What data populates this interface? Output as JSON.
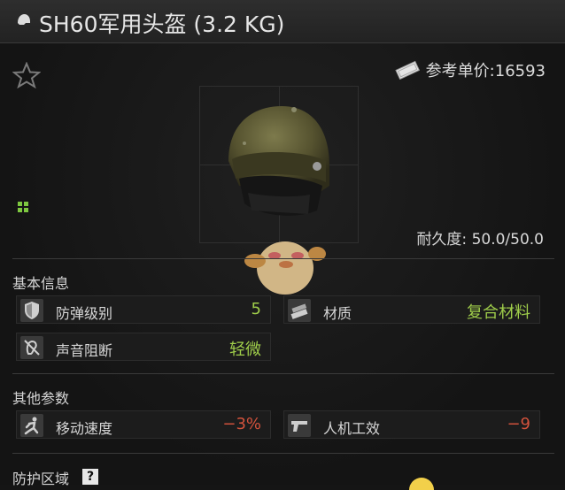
{
  "window": {
    "title": "SH60军用头盔 (3.2 KG)"
  },
  "header": {
    "price_label": "参考单价:16593",
    "durability_label": "耐久度: 50.0/50.0"
  },
  "sections": {
    "basic": {
      "title": "基本信息",
      "stats": [
        {
          "label": "防弹级别",
          "value": "5",
          "icon": "armor-class-icon",
          "color": "#9fcd4a"
        },
        {
          "label": "材质",
          "value": "复合材料",
          "icon": "material-icon",
          "color": "#9fcd4a"
        },
        {
          "label": "声音阻断",
          "value": "轻微",
          "icon": "sound-block-icon",
          "color": "#9fcd4a"
        }
      ]
    },
    "other": {
      "title": "其他参数",
      "stats": [
        {
          "label": "移动速度",
          "value": "−3%",
          "icon": "movement-speed-icon",
          "color": "#d2523c"
        },
        {
          "label": "人机工效",
          "value": "−9",
          "icon": "ergonomics-icon",
          "color": "#d2523c"
        }
      ]
    },
    "protection": {
      "title": "防护区域",
      "help": "?"
    }
  },
  "icons": [
    "helmet-icon",
    "star-icon",
    "money-icon",
    "grid-icon"
  ]
}
